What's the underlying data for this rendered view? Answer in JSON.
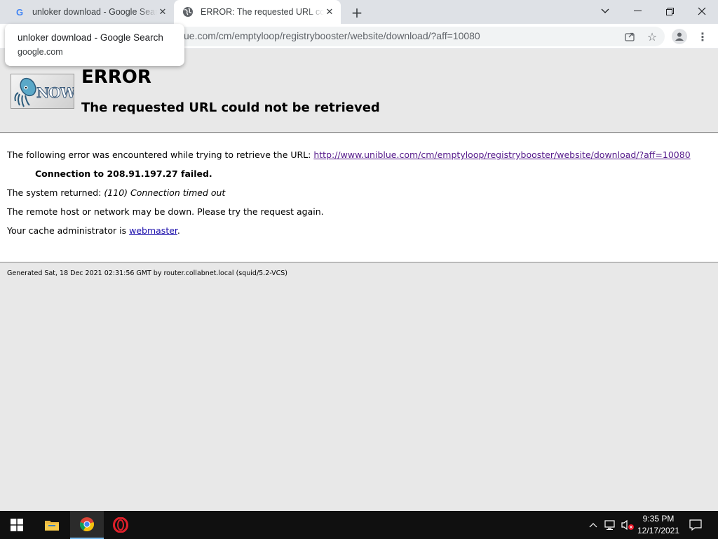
{
  "browser": {
    "tabs": [
      {
        "title": "unloker download - Google Search",
        "favicon": "google-g-icon"
      },
      {
        "title": "ERROR: The requested URL could not be retrieved",
        "favicon": "globe-icon"
      }
    ],
    "url": "ue.com/cm/emptyloop/registrybooster/website/download/?aff=10080",
    "hovercard": {
      "title": "unloker download - Google Search",
      "domain": "google.com"
    }
  },
  "page": {
    "logo_text": "NOW",
    "heading": "ERROR",
    "subheading": "The requested URL could not be retrieved",
    "line1_prefix": "The following error was encountered while trying to retrieve the URL: ",
    "line1_link": "http://www.uniblue.com/cm/emptyloop/registrybooster/website/download/?aff=10080",
    "line2": "Connection to 208.91.197.27 failed.",
    "line3_prefix": "The system returned: ",
    "line3_value": "(110) Connection timed out",
    "line4": "The remote host or network may be down. Please try the request again.",
    "line5_prefix": "Your cache administrator is ",
    "line5_link": "webmaster",
    "line5_suffix": ".",
    "footer": "Generated Sat, 18 Dec 2021 02:31:56 GMT by router.collabnet.local (squid/5.2-VCS)"
  },
  "taskbar": {
    "time": "9:35 PM",
    "date": "12/17/2021"
  },
  "colors": {
    "link": "#1a0dab",
    "visited_link": "#551a8b",
    "page_bg": "#e8e8e8",
    "tabstrip_bg": "#dee1e6",
    "taskbar_bg": "#101010"
  }
}
